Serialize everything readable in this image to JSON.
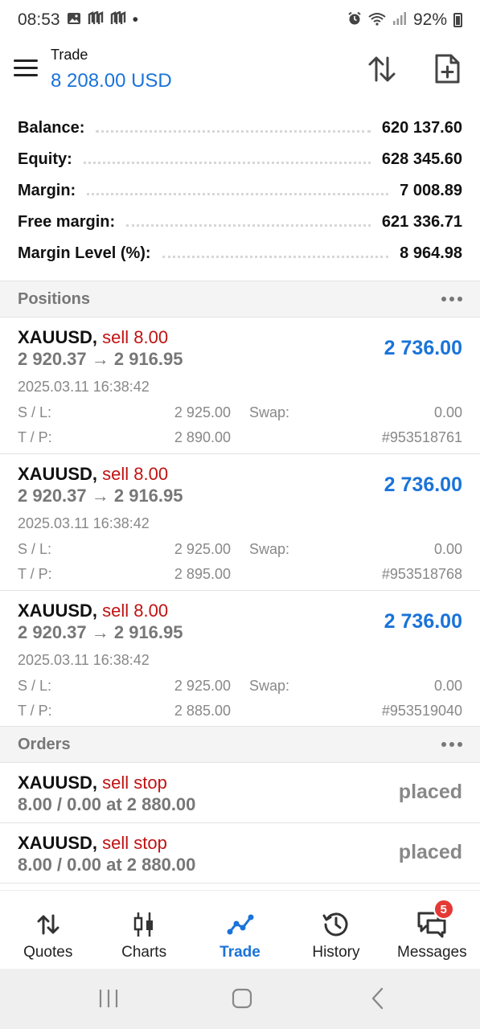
{
  "status_bar": {
    "time": "08:53",
    "dot": "•",
    "battery": "92%"
  },
  "header": {
    "title": "Trade",
    "balance_value": "8 208.00 USD"
  },
  "summary": [
    {
      "label": "Balance:",
      "value": "620 137.60"
    },
    {
      "label": "Equity:",
      "value": "628 345.60"
    },
    {
      "label": "Margin:",
      "value": "7 008.89"
    },
    {
      "label": "Free margin:",
      "value": "621 336.71"
    },
    {
      "label": "Margin Level (%):",
      "value": "8 964.98"
    }
  ],
  "positions": {
    "title": "Positions",
    "items": [
      {
        "symbol": "XAUUSD,",
        "side": "sell 8.00",
        "prices": "2 920.37 → 2 916.95",
        "profit": "2 736.00",
        "time": "2025.03.11 16:38:42",
        "sl_label": "S / L:",
        "sl": "2 925.00",
        "swap_label": "Swap:",
        "swap": "0.00",
        "tp_label": "T / P:",
        "tp": "2 890.00",
        "ticket": "#953518761"
      },
      {
        "symbol": "XAUUSD,",
        "side": "sell 8.00",
        "prices": "2 920.37 → 2 916.95",
        "profit": "2 736.00",
        "time": "2025.03.11 16:38:42",
        "sl_label": "S / L:",
        "sl": "2 925.00",
        "swap_label": "Swap:",
        "swap": "0.00",
        "tp_label": "T / P:",
        "tp": "2 895.00",
        "ticket": "#953518768"
      },
      {
        "symbol": "XAUUSD,",
        "side": "sell 8.00",
        "prices": "2 920.37 → 2 916.95",
        "profit": "2 736.00",
        "time": "2025.03.11 16:38:42",
        "sl_label": "S / L:",
        "sl": "2 925.00",
        "swap_label": "Swap:",
        "swap": "0.00",
        "tp_label": "T / P:",
        "tp": "2 885.00",
        "ticket": "#953519040"
      }
    ]
  },
  "orders": {
    "title": "Orders",
    "items": [
      {
        "symbol": "XAUUSD,",
        "side": "sell stop",
        "desc": "8.00 / 0.00 at 2 880.00",
        "state": "placed"
      },
      {
        "symbol": "XAUUSD,",
        "side": "sell stop",
        "desc": "8.00 / 0.00 at 2 880.00",
        "state": "placed"
      }
    ]
  },
  "bottom_nav": [
    {
      "label": "Quotes",
      "icon": "quotes-icon"
    },
    {
      "label": "Charts",
      "icon": "charts-icon"
    },
    {
      "label": "Trade",
      "icon": "trade-icon",
      "active": true
    },
    {
      "label": "History",
      "icon": "history-icon"
    },
    {
      "label": "Messages",
      "icon": "messages-icon",
      "badge": "5"
    }
  ],
  "colors": {
    "accent": "#1a73d9",
    "sell": "#c01212",
    "badge": "#e53935"
  }
}
